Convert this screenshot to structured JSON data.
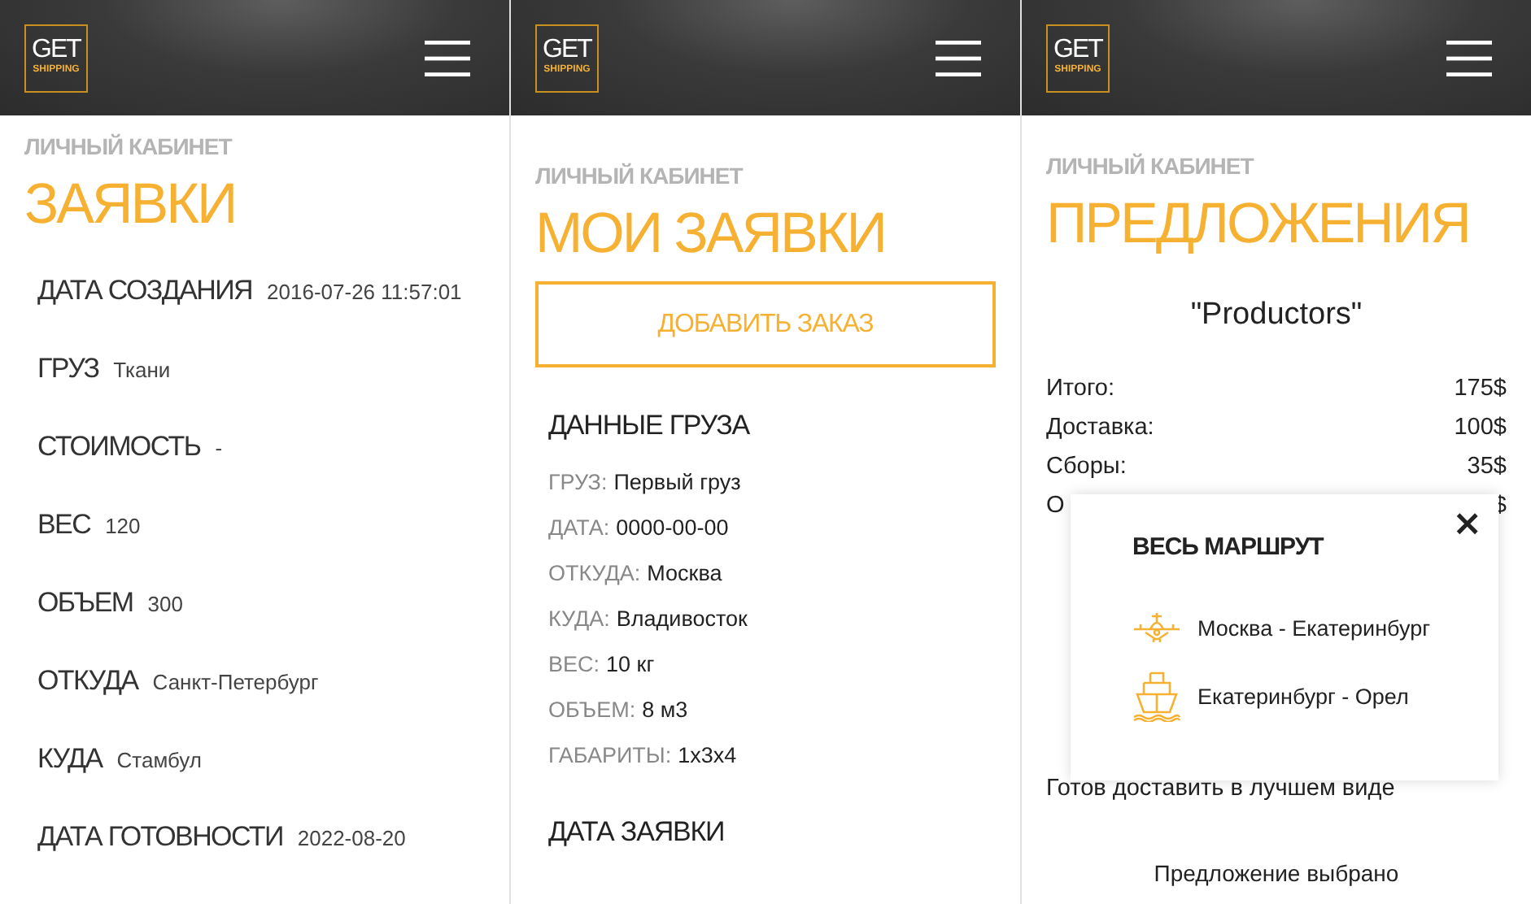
{
  "screens": [
    {
      "logo": {
        "top": "GET",
        "bottom": "SHIPPING"
      },
      "kind": "orders",
      "subtitle": "ЛИЧНЫЙ КАБИНЕТ",
      "title": "ЗАЯВКИ",
      "fields": [
        {
          "label": "ДАТА СОЗДАНИЯ",
          "value": "2016-07-26 11:57:01"
        },
        {
          "label": "ГРУЗ",
          "value": "Ткани"
        },
        {
          "label": "СТОИМОСТЬ",
          "value": "-"
        },
        {
          "label": "ВЕС",
          "value": "120"
        },
        {
          "label": "ОБЪЕМ",
          "value": "300"
        },
        {
          "label": "ОТКУДА",
          "value": "Санкт-Петербург"
        },
        {
          "label": "КУДА",
          "value": "Стамбул"
        },
        {
          "label": "ДАТА ГОТОВНОСТИ",
          "value": "2022-08-20"
        }
      ]
    },
    {
      "logo": {
        "top": "GET",
        "bottom": "SHIPPING"
      },
      "kind": "my_orders",
      "subtitle": "ЛИЧНЫЙ КАБИНЕТ",
      "title": "МОИ ЗАЯВКИ",
      "button": "ДОБАВИТЬ ЗАКАЗ",
      "section": "ДАННЫЕ ГРУЗА",
      "fields": [
        {
          "label": "ГРУЗ:",
          "value": "Первый груз"
        },
        {
          "label": "ДАТА:",
          "value": "0000-00-00"
        },
        {
          "label": "ОТКУДА:",
          "value": "Москва"
        },
        {
          "label": "КУДА:",
          "value": "Владивосток"
        },
        {
          "label": "ВЕС:",
          "value": "10 кг"
        },
        {
          "label": "ОБЪЕМ:",
          "value": "8 м3"
        },
        {
          "label": "ГАБАРИТЫ:",
          "value": "1x3x4"
        }
      ],
      "section_2": "ДАТА ЗАЯВКИ"
    },
    {
      "logo": {
        "top": "GET",
        "bottom": "SHIPPING"
      },
      "kind": "offers",
      "subtitle": "ЛИЧНЫЙ КАБИНЕТ",
      "title": "ПРЕДЛОЖЕНИЯ",
      "company": "\"Productors\"",
      "totals": [
        {
          "label": "Итого:",
          "value": "175$"
        },
        {
          "label": "Доставка:",
          "value": "100$"
        },
        {
          "label": "Сборы:",
          "value": "35$"
        },
        {
          "label": "О",
          "value": "$"
        }
      ],
      "popup": {
        "title": "ВЕСЬ МАРШРУТ",
        "close": "×",
        "legs": [
          {
            "kind": "plane",
            "route": "Москва - Екатеринбург"
          },
          {
            "kind": "ship",
            "route": "Екатеринбург - Орел"
          }
        ]
      },
      "comment": "Готов доставить в лучшем виде",
      "status": "Предложение выбрано"
    }
  ]
}
